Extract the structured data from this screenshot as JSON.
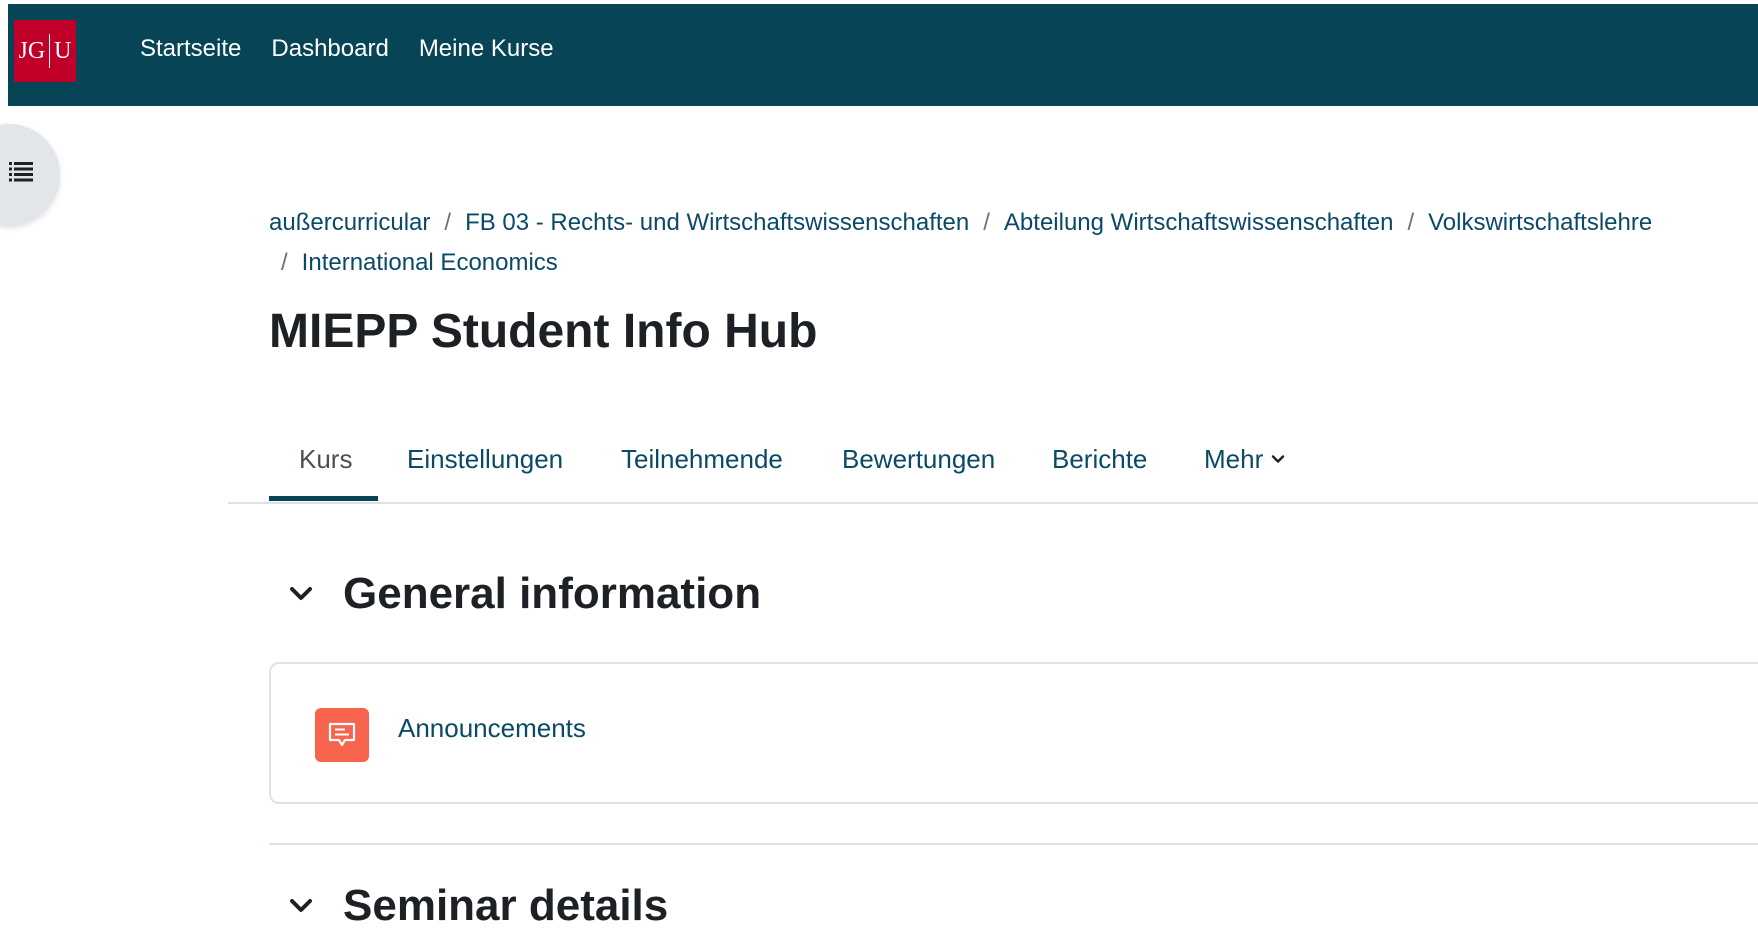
{
  "navbar": {
    "logo_text_left": "JG",
    "logo_text_right": "U",
    "links": [
      "Startseite",
      "Dashboard",
      "Meine Kurse"
    ]
  },
  "breadcrumb": {
    "items": [
      "außercurricular",
      "FB 03 - Rechts- und Wirtschaftswissenschaften",
      "Abteilung Wirtschaftswissenschaften",
      "Volkswirtschaftslehre",
      "International Economics"
    ],
    "separator": "/"
  },
  "page": {
    "title": "MIEPP Student Info Hub"
  },
  "tabs": {
    "items": [
      "Kurs",
      "Einstellungen",
      "Teilnehmende",
      "Bewertungen",
      "Berichte",
      "Mehr"
    ],
    "active": "Kurs"
  },
  "sections": [
    {
      "title": "General information",
      "activities": [
        {
          "label": "Announcements",
          "icon": "forum-icon"
        }
      ]
    },
    {
      "title": "Seminar details"
    }
  ],
  "colors": {
    "navbar": "#074455",
    "logo": "#c1002a",
    "link": "#0a4a66",
    "forum_icon": "#f7634d"
  }
}
